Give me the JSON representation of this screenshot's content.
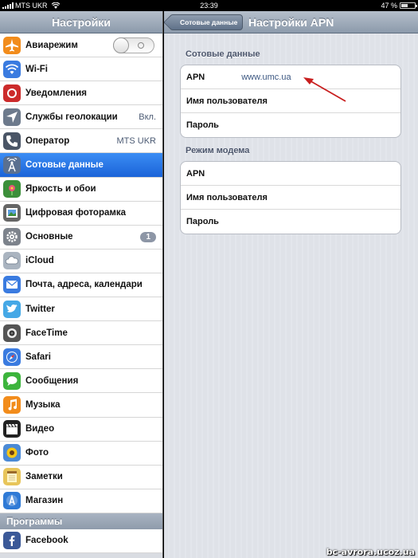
{
  "statusbar": {
    "carrier": "MTS UKR",
    "time": "23:39",
    "battery": "47 %",
    "battery_level": 0.47
  },
  "master": {
    "title": "Настройки",
    "items": [
      {
        "label": "Авиарежим",
        "icon": "airplane-icon",
        "color": "#f28c1b",
        "accessory": "toggle",
        "toggle_on": false
      },
      {
        "label": "Wi-Fi",
        "icon": "wifi-icon",
        "color": "#3a7be0"
      },
      {
        "label": "Уведомления",
        "icon": "notifications-icon",
        "color": "#cc2b2b"
      },
      {
        "label": "Службы геолокации",
        "icon": "location-icon",
        "color": "#6d7a8c",
        "value": "Вкл."
      },
      {
        "label": "Оператор",
        "icon": "carrier-phone-icon",
        "color": "#4a5566",
        "value": "MTS UKR"
      },
      {
        "label": "Сотовые данные",
        "icon": "cellular-antenna-icon",
        "color": "#5a7090",
        "selected": true
      },
      {
        "label": "Яркость и обои",
        "icon": "brightness-flower-icon",
        "color": "#3c8f3a"
      },
      {
        "label": "Цифровая фоторамка",
        "icon": "photo-frame-icon",
        "color": "#666"
      },
      {
        "label": "Основные",
        "icon": "gear-icon",
        "color": "#7d838c",
        "badge": "1"
      },
      {
        "label": "iCloud",
        "icon": "cloud-icon",
        "color": "#aab4c0"
      },
      {
        "label": "Почта, адреса, календари",
        "icon": "mail-icon",
        "color": "#3a7be0"
      },
      {
        "label": "Twitter",
        "icon": "twitter-bird-icon",
        "color": "#45a8e6"
      },
      {
        "label": "FaceTime",
        "icon": "facetime-camera-icon",
        "color": "#555"
      },
      {
        "label": "Safari",
        "icon": "compass-icon",
        "color": "#3a7be0"
      },
      {
        "label": "Сообщения",
        "icon": "speech-bubble-icon",
        "color": "#3cb43c"
      },
      {
        "label": "Музыка",
        "icon": "music-note-icon",
        "color": "#f28c1b"
      },
      {
        "label": "Видео",
        "icon": "clapperboard-icon",
        "color": "#222"
      },
      {
        "label": "Фото",
        "icon": "sunflower-icon",
        "color": "#4b8ad6"
      },
      {
        "label": "Заметки",
        "icon": "notepad-icon",
        "color": "#e8c55a"
      },
      {
        "label": "Магазин",
        "icon": "app-store-icon",
        "color": "#2f7ad6"
      }
    ],
    "section_programs": "Программы",
    "programs": [
      {
        "label": "Facebook",
        "icon": "facebook-icon",
        "color": "#3b5998"
      }
    ]
  },
  "detail": {
    "back_label": "Сотовые данные",
    "title": "Настройки APN",
    "group1_title": "Сотовые данные",
    "group1": [
      {
        "label": "APN",
        "value": "www.umc.ua"
      },
      {
        "label": "Имя пользователя",
        "value": ""
      },
      {
        "label": "Пароль",
        "value": ""
      }
    ],
    "group2_title": "Режим модема",
    "group2": [
      {
        "label": "APN",
        "value": ""
      },
      {
        "label": "Имя пользователя",
        "value": ""
      },
      {
        "label": "Пароль",
        "value": ""
      }
    ],
    "annotation_arrow_color": "#c81e1e"
  },
  "watermark": "bc-avrora.ucoz.ua"
}
